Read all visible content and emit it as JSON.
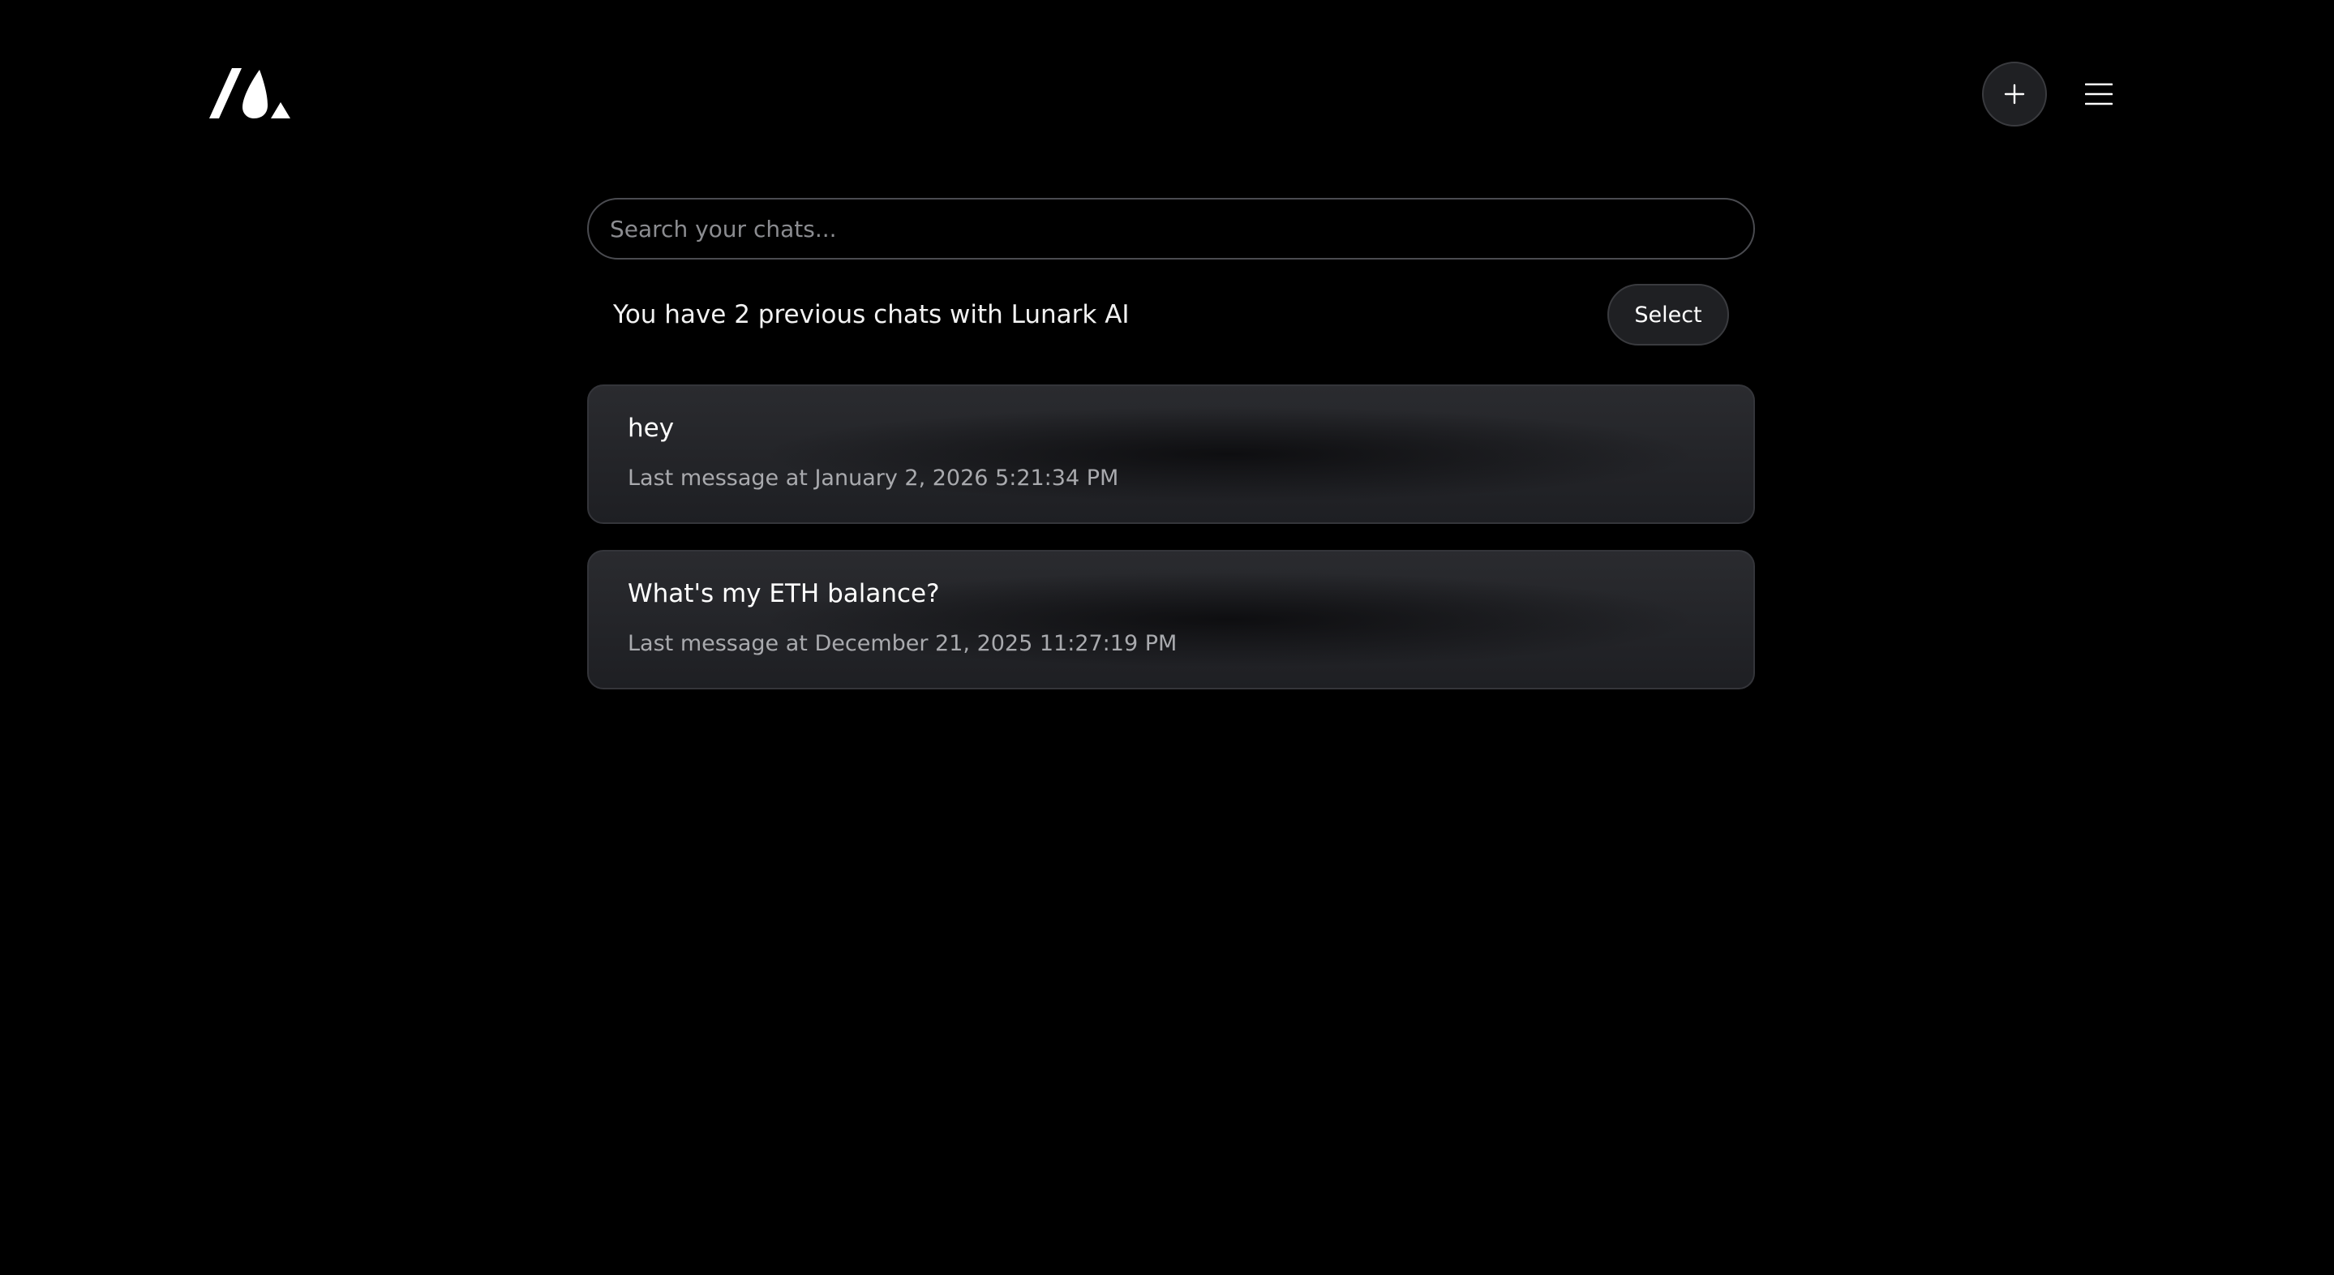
{
  "header": {
    "logo_icon": "lunark-logo-icon",
    "new_chat_icon": "plus-icon",
    "menu_icon": "hamburger-menu-icon"
  },
  "search": {
    "placeholder": "Search your chats...",
    "value": ""
  },
  "summary": {
    "text": "You have 2 previous chats with Lunark AI",
    "select_label": "Select"
  },
  "chats": [
    {
      "title": "hey",
      "last_message": "Last message at January 2, 2026 5:21:34 PM"
    },
    {
      "title": "What's my ETH balance?",
      "last_message": "Last message at December 21, 2025 11:27:19 PM"
    }
  ],
  "colors": {
    "background": "#000000",
    "card": "#26272b",
    "border": "#4a4b50",
    "muted_text": "#a9aaae"
  }
}
